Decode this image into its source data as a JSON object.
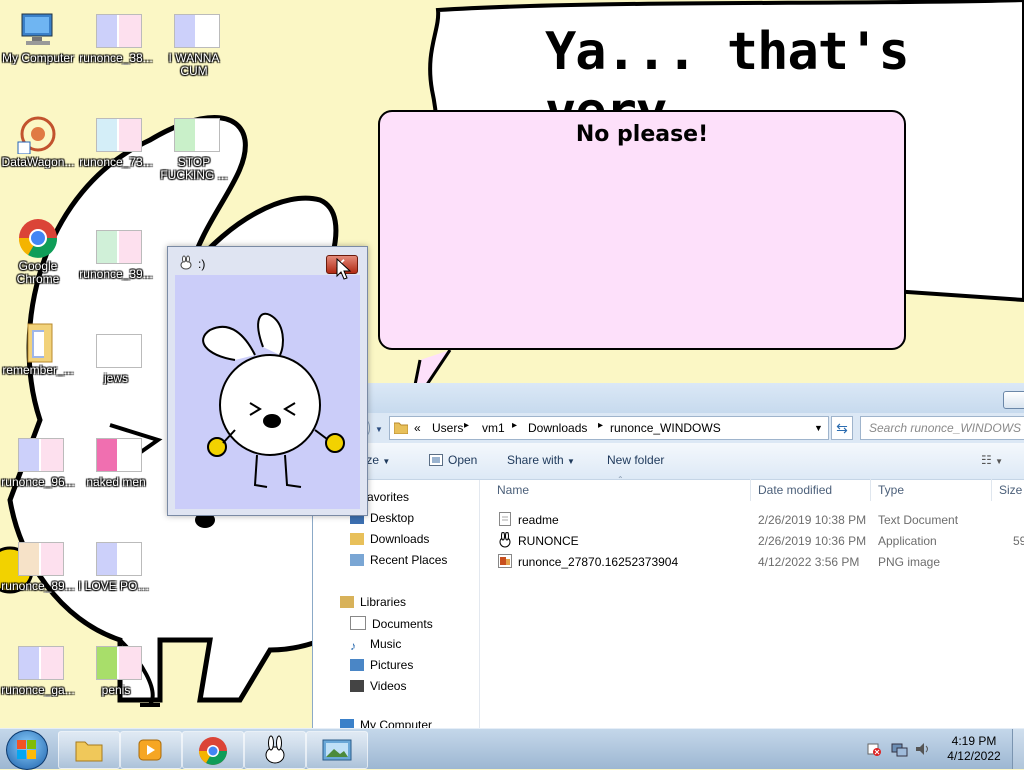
{
  "desktop": {
    "icons": [
      {
        "label": "My Computer"
      },
      {
        "label": "runonce_38..."
      },
      {
        "label": "I WANNA CUM"
      },
      {
        "label": "DataWagon..."
      },
      {
        "label": "runonce_73..."
      },
      {
        "label": "STOP FUCKING ..."
      },
      {
        "label": "Google Chrome"
      },
      {
        "label": "runonce_39..."
      },
      {
        "label": "remember_..."
      },
      {
        "label": "jews"
      },
      {
        "label": "runonce_96..."
      },
      {
        "label": "naked men"
      },
      {
        "label": "runonce_89..."
      },
      {
        "label": "I LOVE PORN"
      },
      {
        "label": "runonce_ga..."
      },
      {
        "label": "penis"
      }
    ],
    "background_text": "Ya... that's very thoughtful."
  },
  "speech_window": {
    "text": "No please!"
  },
  "smiley_window": {
    "title": ":)"
  },
  "explorer": {
    "breadcrumb": [
      "«",
      "Users",
      "vm1",
      "Downloads",
      "runonce_WINDOWS"
    ],
    "search_placeholder": "Search runonce_WINDOWS",
    "toolbar": {
      "organize": "nize",
      "open": "Open",
      "share_with": "Share with",
      "new_folder": "New folder"
    },
    "nav": {
      "favorites": "avorites",
      "items": [
        "Desktop",
        "Downloads",
        "Recent Places"
      ],
      "libraries": "Libraries",
      "lib_items": [
        "Documents",
        "Music",
        "Pictures",
        "Videos"
      ],
      "computer": "My Computer"
    },
    "columns": [
      "Name",
      "Date modified",
      "Type",
      "Size"
    ],
    "files": [
      {
        "name": "readme",
        "date": "2/26/2019 10:38 PM",
        "type": "Text Document",
        "size": ""
      },
      {
        "name": "RUNONCE",
        "date": "2/26/2019 10:36 PM",
        "type": "Application",
        "size": "59"
      },
      {
        "name": "runonce_27870.16252373904",
        "date": "4/12/2022 3:56 PM",
        "type": "PNG image",
        "size": ""
      }
    ]
  },
  "taskbar": {
    "time": "4:19 PM",
    "date": "4/12/2022"
  },
  "colors": {
    "desktop_bg": "#fbf7c5",
    "speech_bg": "#fde0fa",
    "smiley_bg": "#cbcdf9"
  }
}
